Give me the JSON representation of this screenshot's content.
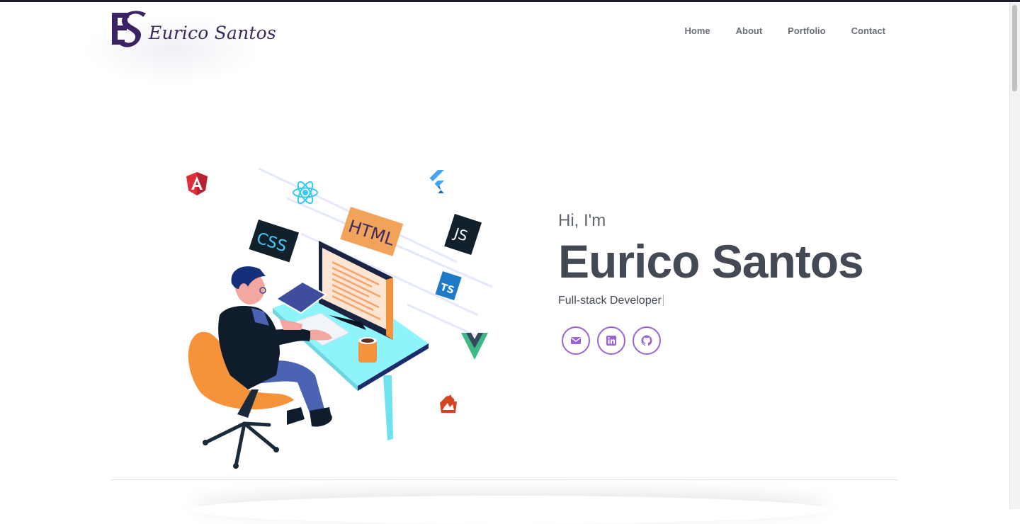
{
  "brand": {
    "monogram": "ES",
    "name": "Eurico Santos",
    "color": "#3b2266"
  },
  "nav": {
    "items": [
      "Home",
      "About",
      "Portfolio",
      "Contact"
    ]
  },
  "hero": {
    "greeting": "Hi, I'm",
    "name": "Eurico Santos",
    "role": "Full-stack Developer",
    "illustration_badges": {
      "css": "CSS",
      "html": "HTML",
      "js": "JS",
      "ts": "TS"
    },
    "social_icons": [
      "envelope-icon",
      "linkedin-icon",
      "github-icon"
    ]
  },
  "colors": {
    "accent": "#9b63d6",
    "heading": "#434a55",
    "nav": "#6b6f77"
  }
}
